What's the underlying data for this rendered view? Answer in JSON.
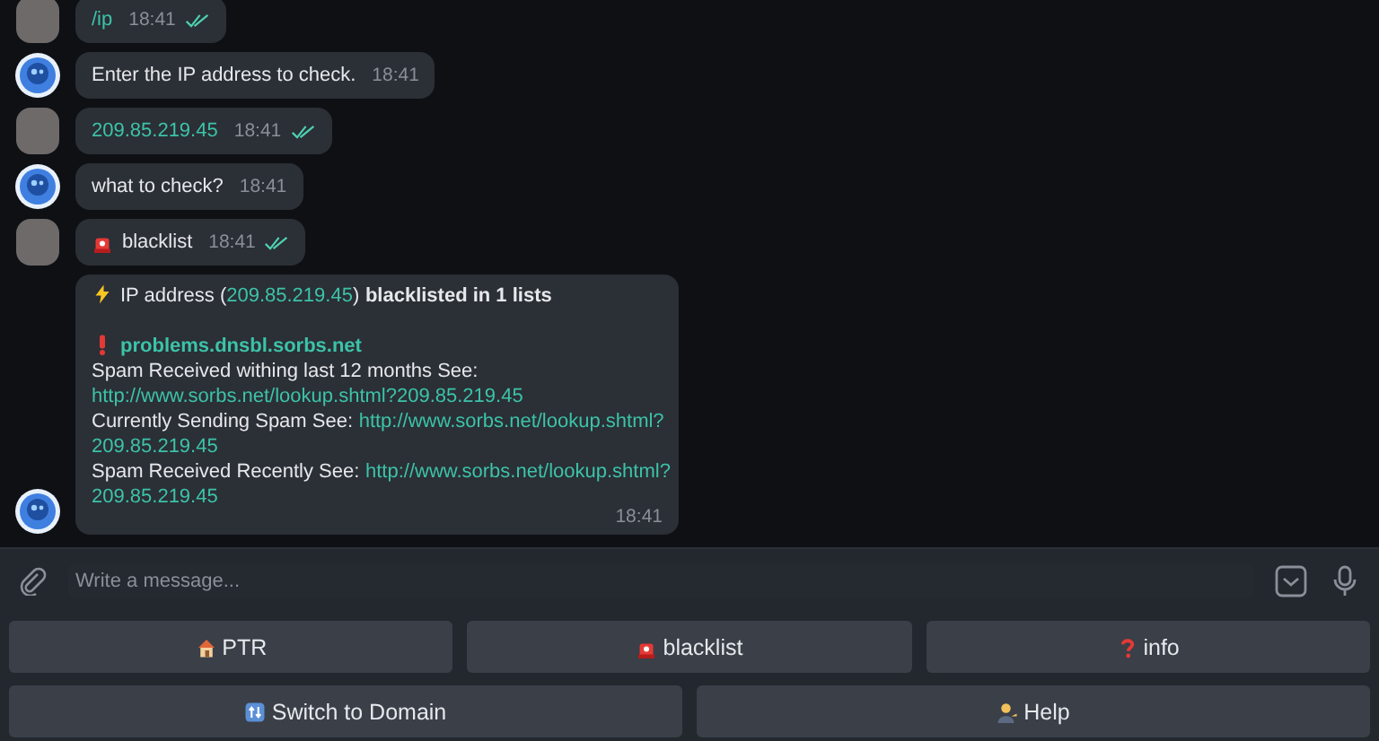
{
  "messages": [
    {
      "kind": "user_link",
      "text": "/ip",
      "time": "18:41",
      "read": true
    },
    {
      "kind": "bot",
      "text": "Enter the IP address to check.",
      "time": "18:41"
    },
    {
      "kind": "user_link",
      "text": "209.85.219.45",
      "time": "18:41",
      "read": true
    },
    {
      "kind": "bot",
      "text": "what to check?",
      "time": "18:41"
    },
    {
      "kind": "user_text",
      "text": "blacklist",
      "time": "18:41",
      "read": true
    },
    {
      "kind": "bot_report",
      "time": "18:41",
      "lines": [
        {
          "parts": [
            {
              "kind": "plain",
              "text": "IP address ("
            },
            {
              "kind": "link",
              "text": "209.85.219.45"
            },
            {
              "kind": "plain",
              "text": ")"
            },
            {
              "kind": "bold",
              "text": "blacklisted in 1 lists",
              "space_before": true
            }
          ]
        },
        {
          "kind": "blank"
        },
        {
          "parts": [
            {
              "kind": "boldlink",
              "text": "problems.dnsbl.sorbs.net"
            }
          ]
        },
        {
          "parts": [
            {
              "kind": "plain",
              "text": "Spam Received withing last 12 months See:"
            }
          ]
        },
        {
          "parts": [
            {
              "kind": "link",
              "text": "http://www.sorbs.net/lookup.shtml?209.85.219.45"
            }
          ]
        },
        {
          "parts": [
            {
              "kind": "plain",
              "text": "Currently Sending Spam See:"
            },
            {
              "kind": "link",
              "text": "http://www.sorbs.net/lookup.shtml?",
              "space_before": true
            }
          ]
        },
        {
          "parts": [
            {
              "kind": "link",
              "text": "209.85.219.45"
            }
          ]
        },
        {
          "parts": [
            {
              "kind": "plain",
              "text": "Spam Received Recently See:"
            },
            {
              "kind": "link",
              "text": "http://www.sorbs.net/lookup.shtml?",
              "space_before": true
            }
          ]
        },
        {
          "parts": [
            {
              "kind": "link",
              "text": "209.85.219.45"
            }
          ]
        }
      ]
    }
  ],
  "composer": {
    "placeholder": "Write a message..."
  },
  "keyboard": [
    [
      {
        "label": "PTR"
      },
      {
        "label": "blacklist"
      },
      {
        "label": "info"
      }
    ],
    [
      {
        "label": "Switch to Domain"
      },
      {
        "label": "Help"
      }
    ]
  ]
}
